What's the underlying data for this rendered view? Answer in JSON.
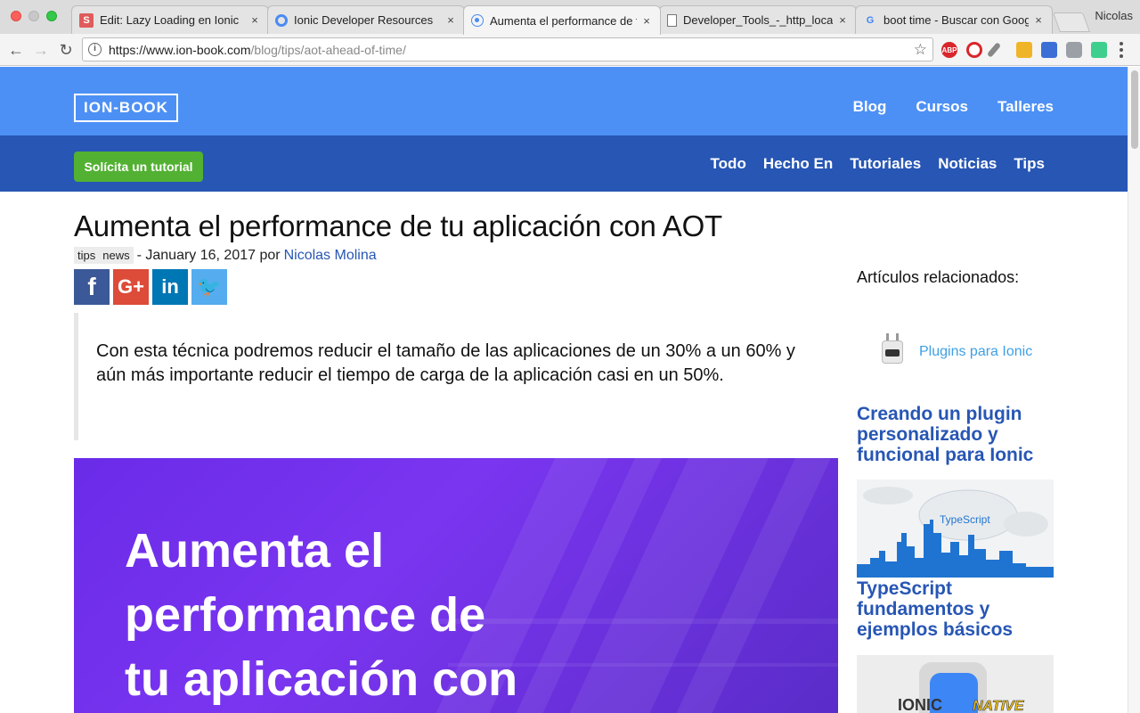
{
  "browser": {
    "tabs": [
      {
        "title": "Edit: Lazy Loading en Ionic",
        "favicon": "s-icon"
      },
      {
        "title": "Ionic Developer Resources",
        "favicon": "ionic-icon"
      },
      {
        "title": "Aumenta el performance de t",
        "favicon": "loading-icon",
        "active": true
      },
      {
        "title": "Developer_Tools_-_http_locali",
        "favicon": "document-icon"
      },
      {
        "title": "boot time - Buscar con Googl",
        "favicon": "google-icon"
      }
    ],
    "close_glyph": "×",
    "profile_name": "Nicolas",
    "url_host": "https://www.ion-book.com",
    "url_path": "/blog/tips/aot-ahead-of-time/",
    "extensions": [
      "ABP",
      "O",
      "",
      "",
      "",
      "",
      ""
    ]
  },
  "site": {
    "logo": "ION-BOOK",
    "main_nav": [
      "Blog",
      "Cursos",
      "Talleres"
    ],
    "cta_label": "Solícita un tutorial",
    "categories": [
      "Todo",
      "Hecho En",
      "Tutoriales",
      "Noticias",
      "Tips"
    ]
  },
  "article": {
    "title": "Aumenta el performance de tu aplicación con AOT",
    "tags": [
      "tips",
      "news"
    ],
    "date_text": "- January 16, 2017 por",
    "author": "Nicolas Molina",
    "share": [
      {
        "name": "facebook",
        "glyph": "f",
        "color": "#3b5998"
      },
      {
        "name": "google-plus",
        "glyph": "G+",
        "color": "#dd4b39"
      },
      {
        "name": "linkedin",
        "glyph": "in",
        "color": "#0077b5"
      },
      {
        "name": "twitter",
        "glyph": "🐦",
        "color": "#55acee"
      }
    ],
    "excerpt": "Con esta técnica podremos reducir el tamaño de las aplicaciones de un 30% a un 60% y aún más importante reducir el tiempo de carga de la aplicación casi en un 50%.",
    "hero_lines": [
      "Aumenta el",
      "performance de",
      "tu aplicación con"
    ]
  },
  "sidebar": {
    "heading": "Artículos relacionados:",
    "plugins_label": "Plugins para Ionic",
    "links": [
      "Creando un plugin personalizado y funcional para Ionic",
      "TypeScript fundamentos y ejemplos básicos"
    ],
    "ts_thumb_label": "TypeScript",
    "native_thumb_label_a": "IONIC",
    "native_thumb_label_b": "NATIVE"
  }
}
